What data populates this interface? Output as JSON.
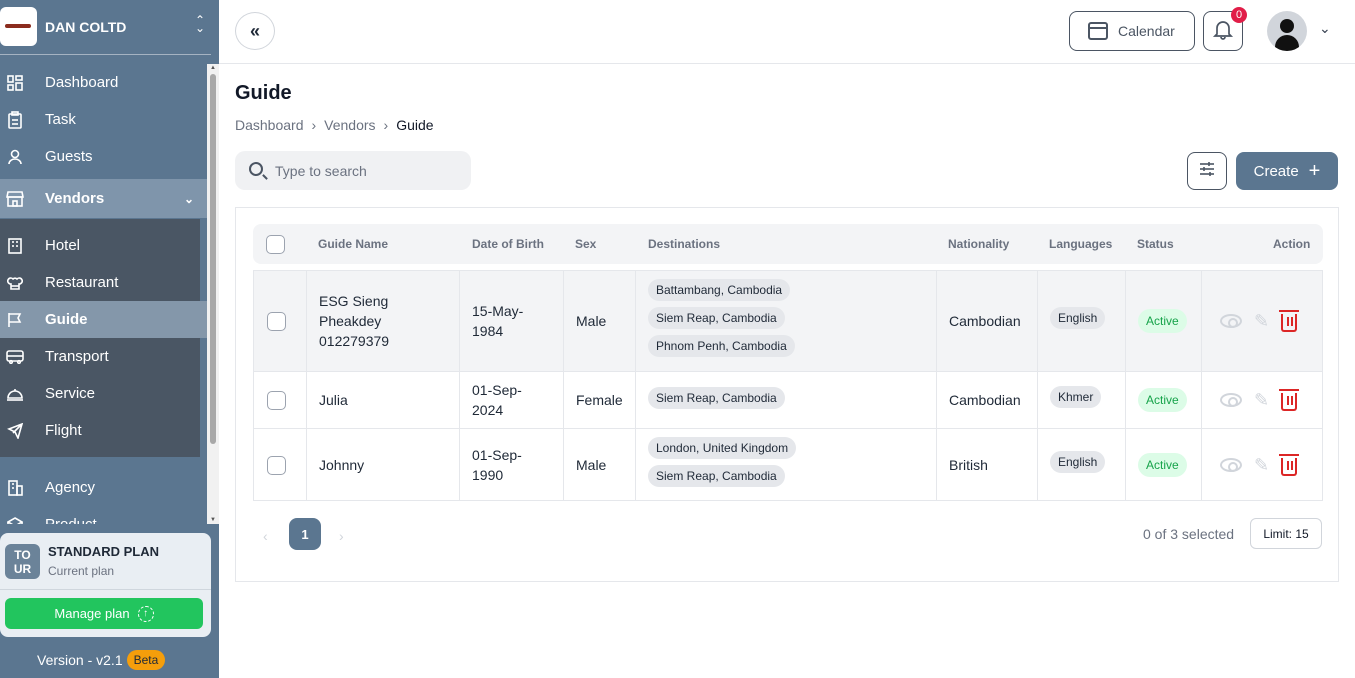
{
  "org": {
    "name": "DAN COLTD",
    "switch_icon": "chevron-up-down-icon"
  },
  "nav": {
    "dashboard": "Dashboard",
    "task": "Task",
    "guests": "Guests",
    "vendors": "Vendors",
    "hotel": "Hotel",
    "restaurant": "Restaurant",
    "guide": "Guide",
    "transport": "Transport",
    "service": "Service",
    "flight": "Flight",
    "agency": "Agency",
    "product": "Product"
  },
  "plan": {
    "logo_text": "TO UR",
    "title": "STANDARD PLAN",
    "subtitle": "Current plan",
    "manage_label": "Manage plan"
  },
  "version": {
    "label": "Version - v2.1",
    "badge": "Beta"
  },
  "topbar": {
    "calendar_label": "Calendar",
    "notification_count": "0"
  },
  "page": {
    "title": "Guide",
    "breadcrumb": [
      "Dashboard",
      "Vendors",
      "Guide"
    ]
  },
  "search": {
    "placeholder": "Type to search"
  },
  "toolbar": {
    "create_label": "Create"
  },
  "table": {
    "headers": [
      "Guide Name",
      "Date of Birth",
      "Sex",
      "Destinations",
      "Nationality",
      "Languages",
      "Status",
      "Action"
    ],
    "rows": [
      {
        "name_lines": [
          "ESG Sieng",
          "Pheakdey",
          "012279379"
        ],
        "dob_lines": [
          "15-May-",
          "1984"
        ],
        "sex": "Male",
        "destinations": [
          "Battambang, Cambodia",
          "Siem Reap, Cambodia",
          "Phnom Penh, Cambodia"
        ],
        "nationality": "Cambodian",
        "language": "English",
        "status": "Active"
      },
      {
        "name_lines": [
          "Julia"
        ],
        "dob_lines": [
          "01-Sep-",
          "2024"
        ],
        "sex": "Female",
        "destinations": [
          "Siem Reap, Cambodia"
        ],
        "nationality": "Cambodian",
        "language": "Khmer",
        "status": "Active"
      },
      {
        "name_lines": [
          "Johnny"
        ],
        "dob_lines": [
          "01-Sep-",
          "1990"
        ],
        "sex": "Male",
        "destinations": [
          "London, United Kingdom",
          "Siem Reap, Cambodia"
        ],
        "nationality": "British",
        "language": "English",
        "status": "Active"
      }
    ]
  },
  "pagination": {
    "prev": "‹",
    "page": "1",
    "next": "›",
    "selected": "0 of 3 selected",
    "limit": "Limit: 15"
  },
  "colors": {
    "sidebar": "#5b7690",
    "submenu": "#4a5664",
    "accent": "#5b7690",
    "success": "#22c55e",
    "danger": "#dc2626"
  }
}
